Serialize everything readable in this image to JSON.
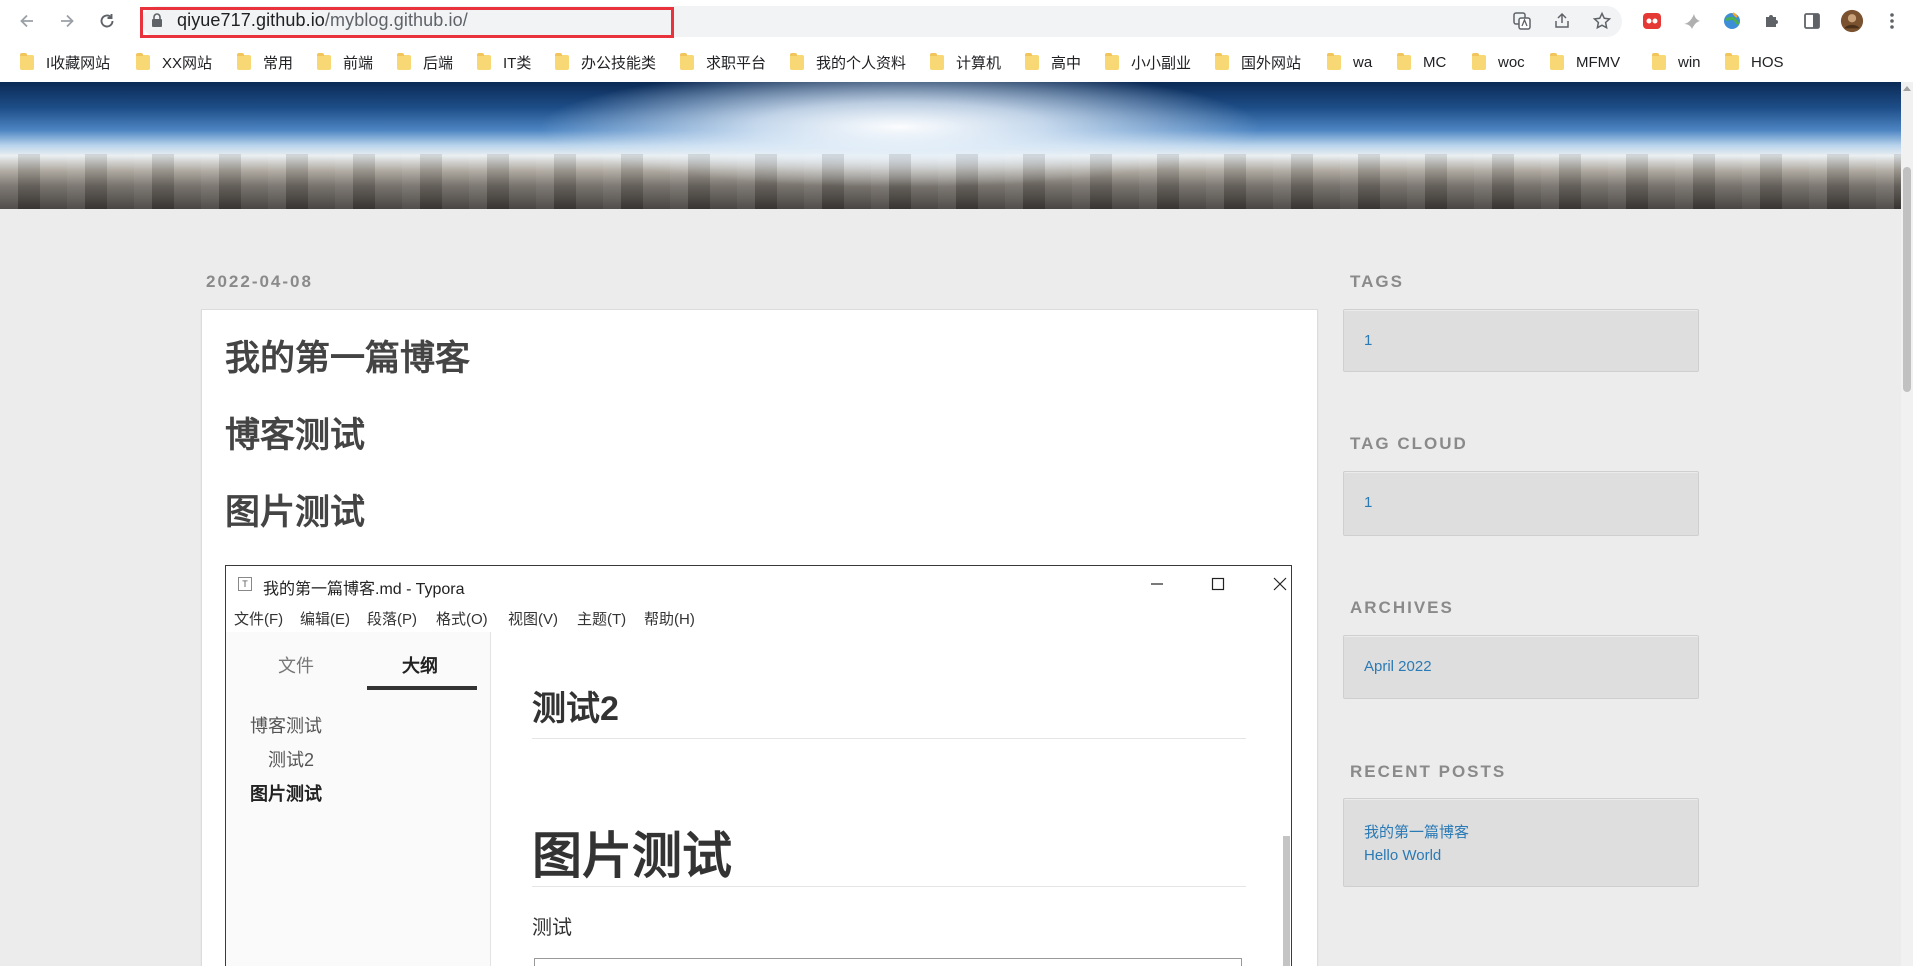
{
  "browser": {
    "url_host": "qiyue717.github.io",
    "url_path": "/myblog.github.io/",
    "bookmarks": [
      "I收藏网站",
      "XX网站",
      "常用",
      "前端",
      "后端",
      "IT类",
      "办公技能类",
      "求职平台",
      "我的个人资料",
      "计算机",
      "高中",
      "小小副业",
      "国外网站",
      "wa",
      "MC",
      "woc",
      "MFMV",
      "win",
      "HOS"
    ]
  },
  "post": {
    "date": "2022-04-08",
    "title": "我的第一篇博客",
    "heading2": "博客测试",
    "heading3": "图片测试"
  },
  "typora": {
    "window_title": "我的第一篇博客.md - Typora",
    "menu": [
      "文件(F)",
      "编辑(E)",
      "段落(P)",
      "格式(O)",
      "视图(V)",
      "主题(T)",
      "帮助(H)"
    ],
    "tab_files": "文件",
    "tab_outline": "大纲",
    "outline": [
      "博客测试",
      "测试2",
      "图片测试"
    ],
    "editor_h2": "测试2",
    "editor_h1": "图片测试",
    "editor_para": "测试"
  },
  "sidebar": {
    "tags_title": "TAGS",
    "tags": [
      "1"
    ],
    "tagcloud_title": "TAG CLOUD",
    "tagcloud": [
      "1"
    ],
    "archives_title": "ARCHIVES",
    "archives": [
      "April 2022"
    ],
    "recent_title": "RECENT POSTS",
    "recent": [
      "我的第一篇博客",
      "Hello World"
    ]
  },
  "colors": {
    "url_highlight": "#e8323c",
    "link": "#2a7ab5",
    "page_background": "#ececec"
  }
}
